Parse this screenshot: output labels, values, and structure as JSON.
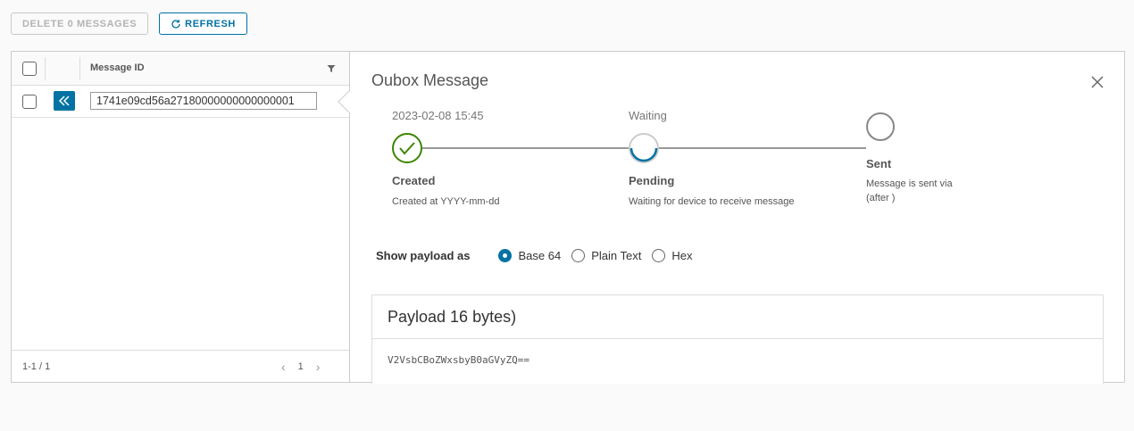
{
  "toolbar": {
    "delete_label": "DELETE 0 MESSAGES",
    "refresh_label": "REFRESH"
  },
  "grid": {
    "column_header": "Message ID",
    "rows": [
      {
        "message_id": "1741e09cd56a27180000000000000001"
      }
    ],
    "footer_count": "1-1 / 1",
    "page": "1"
  },
  "detail": {
    "title": "Oubox Message",
    "steps": [
      {
        "timestamp": "2023-02-08 15:45",
        "title": "Created",
        "desc": "Created at YYYY-mm-dd",
        "state": "done"
      },
      {
        "timestamp": "Waiting",
        "title": "Pending",
        "desc": "Waiting for device to receive message",
        "state": "in-progress"
      },
      {
        "timestamp": "",
        "title": "Sent",
        "desc": "Message is sent via (after )",
        "state": "not-started"
      }
    ],
    "payload_label": "Show payload as",
    "payload_options": [
      "Base 64",
      "Plain Text",
      "Hex"
    ],
    "payload_selected": "Base 64",
    "payload_title": "Payload 16 bytes)",
    "payload_value": "V2VsbCBoZWxsbyB0aGVyZQ=="
  },
  "colors": {
    "primary": "#0072a3",
    "success": "#3c8500"
  }
}
